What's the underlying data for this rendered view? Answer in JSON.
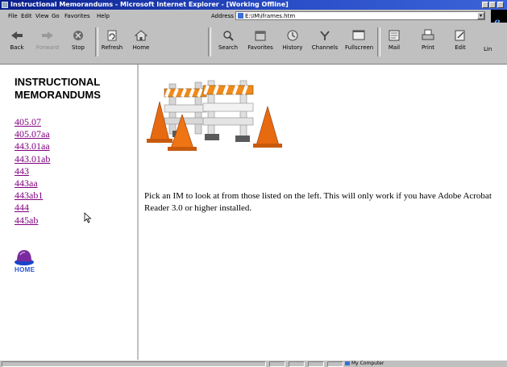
{
  "window": {
    "title": "Instructional Memorandums - Microsoft Internet Explorer - [Working Offline]"
  },
  "menu": [
    "File",
    "Edit",
    "View",
    "Go",
    "Favorites",
    "Help"
  ],
  "address": {
    "label": "Address",
    "value": "E:\\IM\\iframes.htm"
  },
  "toolbar": [
    {
      "label": "Back",
      "icon": "back-icon",
      "enabled": true
    },
    {
      "label": "Forward",
      "icon": "forward-icon",
      "enabled": false
    },
    {
      "label": "Stop",
      "icon": "stop-icon",
      "enabled": true
    },
    {
      "label": "Refresh",
      "icon": "refresh-icon",
      "enabled": true
    },
    {
      "label": "Home",
      "icon": "home-icon",
      "enabled": true
    },
    {
      "label": "Search",
      "icon": "search-icon",
      "enabled": true
    },
    {
      "label": "Favorites",
      "icon": "favorites-icon",
      "enabled": true
    },
    {
      "label": "History",
      "icon": "history-icon",
      "enabled": true
    },
    {
      "label": "Channels",
      "icon": "channels-icon",
      "enabled": true
    },
    {
      "label": "Fullscreen",
      "icon": "fullscreen-icon",
      "enabled": true
    },
    {
      "label": "Mail",
      "icon": "mail-icon",
      "enabled": true
    },
    {
      "label": "Print",
      "icon": "print-icon",
      "enabled": true
    },
    {
      "label": "Edit",
      "icon": "edit-icon",
      "enabled": true
    },
    {
      "label": "Lin",
      "icon": "links",
      "enabled": true
    }
  ],
  "nav": {
    "heading_line1": "INSTRUCTIONAL",
    "heading_line2": "MEMORANDUMS",
    "links": [
      "405.07",
      "405.07aa",
      "443.01aa",
      "443.01ab",
      "443",
      "443aa",
      "443ab1",
      "444",
      "445ab"
    ],
    "home_label": "HOME"
  },
  "main": {
    "instructions": "Pick an IM to look at from those listed on the left.  This will only work if you have Adobe Acrobat Reader 3.0 or higher installed."
  },
  "status": {
    "zone": "My Computer"
  },
  "colors": {
    "titlebar": "#0a1f8c",
    "link_visited": "#800080",
    "home_label": "#2b55d8",
    "chrome": "#c0c0c0"
  }
}
